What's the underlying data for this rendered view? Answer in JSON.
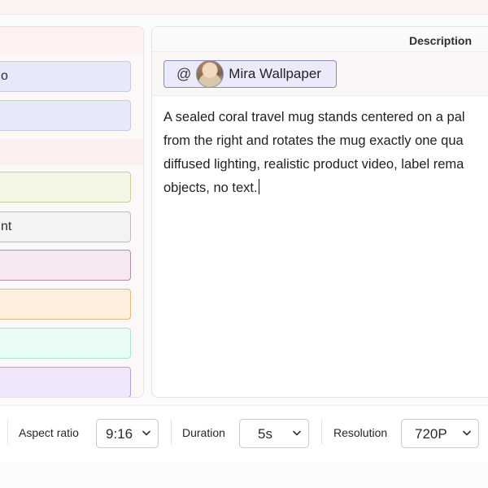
{
  "left_panel": {
    "options": [
      {
        "label": "o"
      },
      {
        "label": ""
      },
      {
        "label": ""
      },
      {
        "label": "nt"
      },
      {
        "label": ""
      },
      {
        "label": ""
      },
      {
        "label": ""
      },
      {
        "label": ""
      }
    ]
  },
  "right_panel": {
    "title": "Description",
    "mention": {
      "at_symbol": "@",
      "name": "Mira Wallpaper"
    },
    "description_lines": [
      "A sealed coral travel mug stands centered on a pal",
      "from the right and rotates the mug exactly one qua",
      "diffused lighting, realistic product video, label rema",
      "objects, no text."
    ]
  },
  "toolbar": {
    "aspect_ratio": {
      "label": "Aspect ratio",
      "value": "9:16"
    },
    "duration": {
      "label": "Duration",
      "value": "5s"
    },
    "resolution": {
      "label": "Resolution",
      "value": "720P"
    }
  },
  "icons": {
    "dropdown": "chevron-down-icon"
  }
}
